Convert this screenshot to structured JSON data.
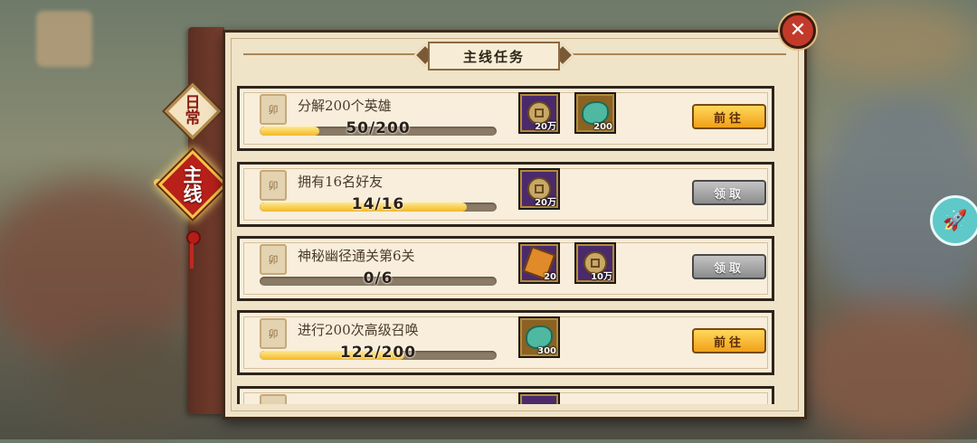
{
  "panel": {
    "title": "主线任务",
    "close_icon": "close-icon"
  },
  "tabs": [
    {
      "id": "daily",
      "label": "日常",
      "active": false
    },
    {
      "id": "main",
      "label": "主线",
      "active": true
    }
  ],
  "colors": {
    "active_tab": "#b8201a",
    "go_button": "#f0a01a",
    "claim_button": "#8c8c8c",
    "progress_fill": "#f2b92a"
  },
  "quests": [
    {
      "name": "分解200个英雄",
      "progress_text": "50/200",
      "progress": 0.25,
      "rewards": [
        {
          "icon": "copper-coin-icon",
          "count": "20万"
        },
        {
          "icon": "jade-icon",
          "count": "200"
        }
      ],
      "button": "前往",
      "button_state": "go"
    },
    {
      "name": "拥有16名好友",
      "progress_text": "14/16",
      "progress": 0.875,
      "rewards": [
        {
          "icon": "copper-coin-icon",
          "count": "20万"
        }
      ],
      "button": "领取",
      "button_state": "claim"
    },
    {
      "name": "神秘幽径通关第6关",
      "progress_text": "0/6",
      "progress": 0,
      "rewards": [
        {
          "icon": "scroll-item-icon",
          "count": "20"
        },
        {
          "icon": "copper-coin-icon",
          "count": "10万"
        }
      ],
      "button": "领取",
      "button_state": "claim"
    },
    {
      "name": "进行200次高级召唤",
      "progress_text": "122/200",
      "progress": 0.61,
      "rewards": [
        {
          "icon": "jade-icon",
          "count": "300"
        }
      ],
      "button": "前往",
      "button_state": "go"
    }
  ],
  "side_button": {
    "icon": "rocket-icon"
  }
}
